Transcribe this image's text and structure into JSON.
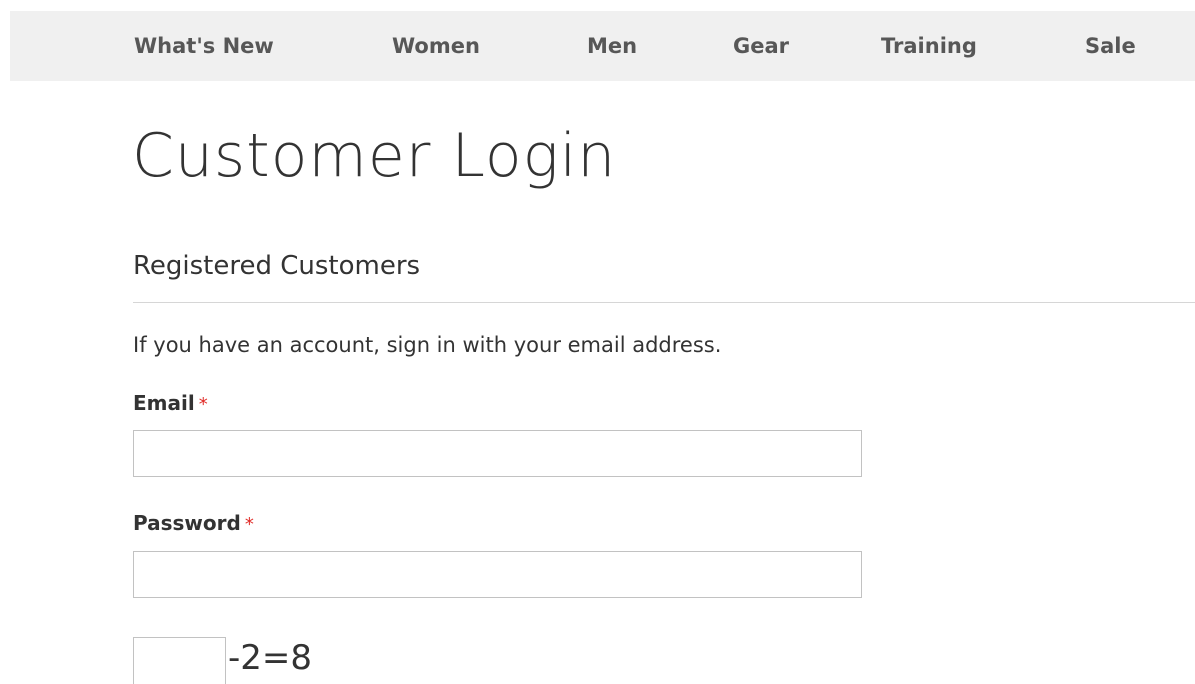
{
  "nav": {
    "items": [
      {
        "label": "What's New"
      },
      {
        "label": "Women"
      },
      {
        "label": "Men"
      },
      {
        "label": "Gear"
      },
      {
        "label": "Training"
      },
      {
        "label": "Sale"
      }
    ]
  },
  "page": {
    "title": "Customer Login"
  },
  "login": {
    "section_title": "Registered Customers",
    "intro": "If you have an account, sign in with your email address.",
    "email": {
      "label": "Email",
      "required_mark": "*",
      "value": ""
    },
    "password": {
      "label": "Password",
      "required_mark": "*",
      "value": ""
    },
    "captcha": {
      "value": "",
      "equation": "-2=8"
    }
  },
  "colors": {
    "nav_background": "#f0f0f0",
    "required": "#e02b27",
    "text": "#333333",
    "border": "#c2c2c2"
  }
}
